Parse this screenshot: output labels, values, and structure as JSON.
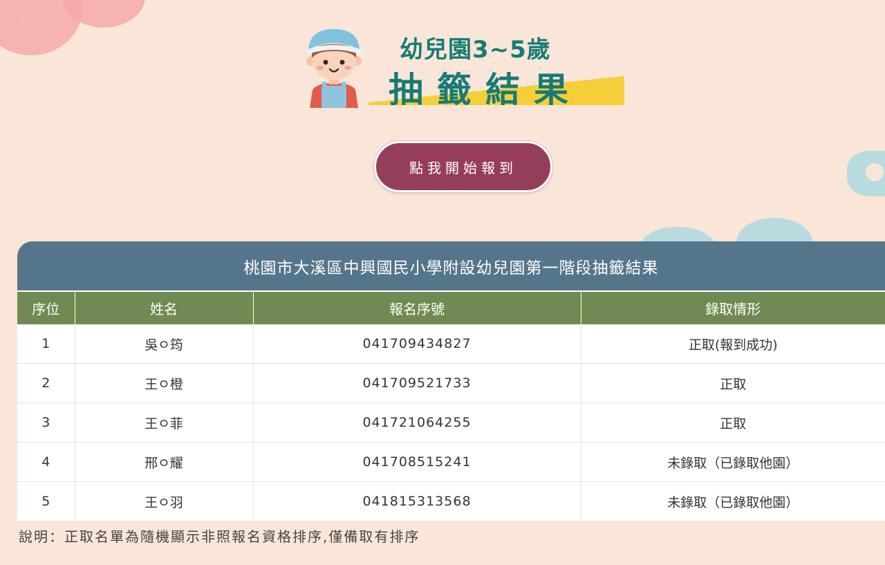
{
  "header": {
    "title_line1": "幼兒園3~5歲",
    "title_line2": "抽籤結果"
  },
  "checkin_button": {
    "label": "點我開始報到"
  },
  "results": {
    "title": "桃園市大溪區中興國民小學附設幼兒園第一階段抽籤結果",
    "columns": [
      "序位",
      "姓名",
      "報名序號",
      "錄取情形"
    ],
    "rows": [
      {
        "rank": "1",
        "name": "吳ㅇ筠",
        "serial": "041709434827",
        "status": "正取(報到成功)"
      },
      {
        "rank": "2",
        "name": "王ㅇ橙",
        "serial": "041709521733",
        "status": "正取"
      },
      {
        "rank": "3",
        "name": "王ㅇ菲",
        "serial": "041721064255",
        "status": "正取"
      },
      {
        "rank": "4",
        "name": "邢ㅇ耀",
        "serial": "041708515241",
        "status": "未錄取（已錄取他園）"
      },
      {
        "rank": "5",
        "name": "王ㅇ羽",
        "serial": "041815313568",
        "status": "未錄取（已錄取他園）"
      }
    ]
  },
  "note": "說明：正取名單為隨機顯示非照報名資格排序,僅備取有排序",
  "colors": {
    "background": "#f9e6d8",
    "title_teal": "#177b74",
    "button": "#953e5a",
    "table_title_bar": "#55768a",
    "table_header": "#718a53",
    "banner_yellow": "#f5cf3a"
  },
  "icons": {
    "mascot": "child-mascot-icon"
  }
}
